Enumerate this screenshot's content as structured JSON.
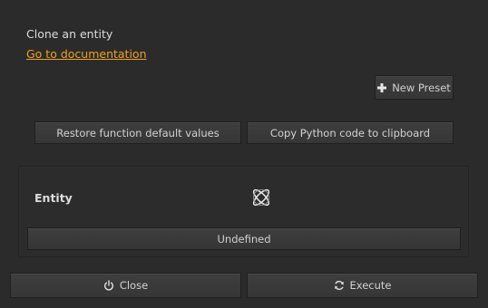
{
  "header": {
    "title": "Clone an entity",
    "doc_link": "Go to documentation"
  },
  "presets": {
    "new_preset_label": "New Preset",
    "new_preset_icon": "plus-icon"
  },
  "actions": {
    "restore_label": "Restore function default values",
    "copy_python_label": "Copy Python code to clipboard"
  },
  "entity": {
    "label": "Entity",
    "picker_icon": "pick-entity-icon",
    "value": "Undefined"
  },
  "footer": {
    "close_label": "Close",
    "close_icon": "power-icon",
    "execute_label": "Execute",
    "execute_icon": "refresh-icon"
  },
  "colors": {
    "background": "#2b2b2b",
    "link": "#f0a31a",
    "button": "#3a3a3a",
    "text": "#d7d7d7"
  }
}
